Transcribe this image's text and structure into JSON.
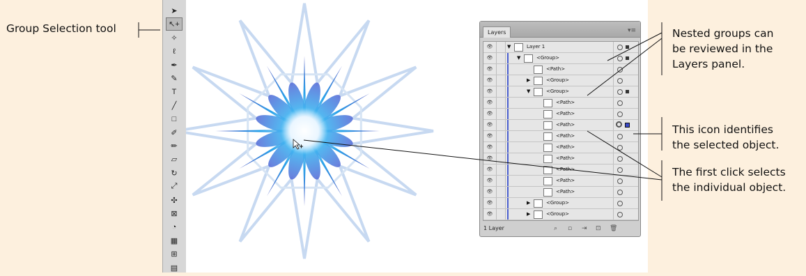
{
  "callouts": {
    "group_selection": "Group Selection tool",
    "nested_groups": "Nested groups can\nbe reviewed in the\nLayers panel.",
    "selected_icon": "This icon identifies\nthe selected object.",
    "first_click": "The first click selects\nthe individual object."
  },
  "toolbar": {
    "tools": [
      {
        "icon": "selection-arrow-icon",
        "glyph": "➤"
      },
      {
        "icon": "group-selection-icon",
        "glyph": "↖+",
        "selected": true
      },
      {
        "icon": "magic-wand-icon",
        "glyph": "✧"
      },
      {
        "icon": "lasso-icon",
        "glyph": "ℓ"
      },
      {
        "icon": "pen-icon",
        "glyph": "✒"
      },
      {
        "icon": "curvature-pen-icon",
        "glyph": "✎"
      },
      {
        "icon": "type-icon",
        "glyph": "T"
      },
      {
        "icon": "line-segment-icon",
        "glyph": "╱"
      },
      {
        "icon": "rectangle-icon",
        "glyph": "□"
      },
      {
        "icon": "paintbrush-icon",
        "glyph": "✐"
      },
      {
        "icon": "pencil-icon",
        "glyph": "✏"
      },
      {
        "icon": "eraser-icon",
        "glyph": "▱"
      },
      {
        "icon": "rotate-icon",
        "glyph": "↻"
      },
      {
        "icon": "scale-icon",
        "glyph": "⤢"
      },
      {
        "icon": "puppet-warp-icon",
        "glyph": "✣"
      },
      {
        "icon": "free-transform-icon",
        "glyph": "⊠"
      },
      {
        "icon": "shape-builder-icon",
        "glyph": "◔"
      },
      {
        "icon": "perspective-grid-icon",
        "glyph": "▦"
      },
      {
        "icon": "mesh-icon",
        "glyph": "⊞"
      },
      {
        "icon": "gradient-icon",
        "glyph": "▤"
      }
    ]
  },
  "layers_panel": {
    "tab_label": "Layers",
    "menu_icon": "panel-menu-icon",
    "rows": [
      {
        "label": "Layer 1",
        "indent": 0,
        "arrow": "down",
        "target": "normal",
        "square": true
      },
      {
        "label": "<Group>",
        "indent": 1,
        "arrow": "down",
        "target": "normal",
        "square": true
      },
      {
        "label": "<Path>",
        "indent": 2,
        "arrow": "none",
        "target": "normal",
        "square": false
      },
      {
        "label": "<Group>",
        "indent": 2,
        "arrow": "right",
        "target": "normal",
        "square": false
      },
      {
        "label": "<Group>",
        "indent": 2,
        "arrow": "down",
        "target": "normal",
        "square": true
      },
      {
        "label": "<Path>",
        "indent": 3,
        "arrow": "none",
        "target": "normal",
        "square": false
      },
      {
        "label": "<Path>",
        "indent": 3,
        "arrow": "none",
        "target": "normal",
        "square": false
      },
      {
        "label": "<Path>",
        "indent": 3,
        "arrow": "none",
        "target": "selected",
        "square": true,
        "square_color": "blue"
      },
      {
        "label": "<Path>",
        "indent": 3,
        "arrow": "none",
        "target": "normal",
        "square": false
      },
      {
        "label": "<Path>",
        "indent": 3,
        "arrow": "none",
        "target": "normal",
        "square": false
      },
      {
        "label": "<Path>",
        "indent": 3,
        "arrow": "none",
        "target": "normal",
        "square": false
      },
      {
        "label": "<Path>",
        "indent": 3,
        "arrow": "none",
        "target": "normal",
        "square": false
      },
      {
        "label": "<Path>",
        "indent": 3,
        "arrow": "none",
        "target": "normal",
        "square": false
      },
      {
        "label": "<Path>",
        "indent": 3,
        "arrow": "none",
        "target": "normal",
        "square": false
      },
      {
        "label": "<Group>",
        "indent": 2,
        "arrow": "right",
        "target": "normal",
        "square": false
      },
      {
        "label": "<Group>",
        "indent": 2,
        "arrow": "right",
        "target": "normal",
        "square": false
      }
    ],
    "footer": {
      "count": "1 Layer",
      "icons": [
        "locate-object-icon",
        "make-clipping-mask-icon",
        "create-sublayer-icon",
        "new-layer-icon",
        "delete-layer-icon"
      ]
    }
  },
  "colors": {
    "background": "#fdf0de",
    "accent_blue": "#1aa3e8",
    "pale_blue": "#c7d9f1",
    "selection_blue": "#3a49c8"
  }
}
